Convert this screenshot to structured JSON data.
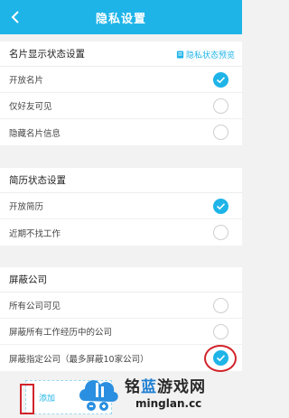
{
  "header": {
    "title": "隐私设置"
  },
  "card_section": {
    "title": "名片显示状态设置",
    "preview_link": "隐私状态预览",
    "options": [
      "开放名片",
      "仅好友可见",
      "隐藏名片信息"
    ],
    "selected": 0
  },
  "resume_section": {
    "title": "简历状态设置",
    "options": [
      "开放简历",
      "近期不找工作"
    ],
    "selected": 0
  },
  "block_section": {
    "title": "屏蔽公司",
    "options": [
      "所有公司可见",
      "屏蔽所有工作经历中的公司",
      "屏蔽指定公司（最多屏蔽10家公司）"
    ],
    "selected": 2
  },
  "add_button": {
    "label": "添加"
  },
  "watermark": {
    "name_part1": "铭",
    "name_part2": "蓝",
    "name_part3": "游戏网",
    "domain": "minglan.cc"
  },
  "colors": {
    "accent": "#1fb4e8",
    "annotation": "#d2232a"
  }
}
